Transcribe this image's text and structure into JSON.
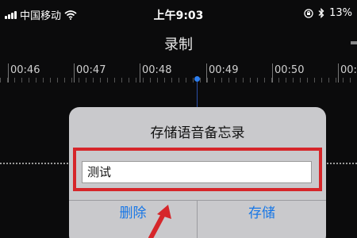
{
  "status_bar": {
    "carrier": "中国移动",
    "time": "上午9:03",
    "battery": "13%"
  },
  "nav": {
    "title": "录制"
  },
  "timeline": {
    "labels": [
      "00:46",
      "00:47",
      "00:48",
      "00:49",
      "00:50",
      "00:5"
    ]
  },
  "alert": {
    "title": "存储语音备忘录",
    "input_value": "测试",
    "delete_label": "删除",
    "save_label": "存储"
  },
  "colors": {
    "accent": "#1877e6",
    "highlight": "#d6262a",
    "playhead": "#2d7ff0"
  },
  "icons": [
    "signal-icon",
    "wifi-icon",
    "orientation-lock-icon",
    "bluetooth-icon",
    "battery-icon",
    "annotation-arrow-icon"
  ]
}
